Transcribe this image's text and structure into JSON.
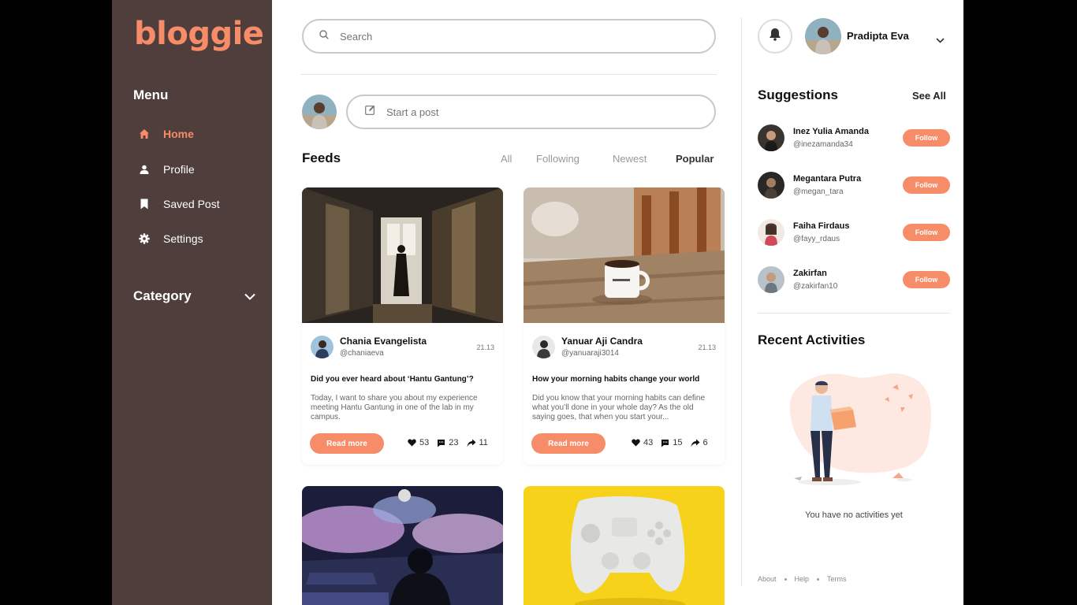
{
  "brand": {
    "logo": "bloggie",
    "accent": "#f78c68",
    "sidebar_bg": "#4f3e3c"
  },
  "sidebar": {
    "menu_title": "Menu",
    "items": [
      {
        "label": "Home",
        "icon": "home-icon",
        "active": true
      },
      {
        "label": "Profile",
        "icon": "user-icon"
      },
      {
        "label": "Saved Post",
        "icon": "bookmark-icon"
      },
      {
        "label": "Settings",
        "icon": "gear-icon"
      }
    ],
    "category_label": "Category"
  },
  "search": {
    "placeholder": "Search"
  },
  "composer": {
    "placeholder": "Start a post"
  },
  "feeds": {
    "title": "Feeds",
    "filters": [
      "All",
      "Following",
      "Newest",
      "Popular"
    ],
    "active_filter": "Popular",
    "posts": [
      {
        "author": "Chania Evangelista",
        "handle": "@chaniaeva",
        "time": "21.13",
        "title": "Did you ever heard about ‘Hantu Gantung’?",
        "excerpt": "Today, I want to share you about my experience meeting Hantu Gantung in one of the lab in my campus.",
        "button": "Read more",
        "likes": "53",
        "comments": "23",
        "shares": "11"
      },
      {
        "author": "Yanuar Aji Candra",
        "handle": "@yanuaraji3014",
        "time": "21.13",
        "title": "How your morning habits change your world",
        "excerpt": "Did you know that your morning habits can define what you’ll done in your whole day? As the old saying goes, that when you start your...",
        "button": "Read more",
        "likes": "43",
        "comments": "15",
        "shares": "6"
      }
    ]
  },
  "header": {
    "user_name": "Pradipta Eva"
  },
  "suggestions": {
    "title": "Suggestions",
    "see_all": "See All",
    "items": [
      {
        "name": "Inez Yulia Amanda",
        "handle": "@inezamanda34",
        "button": "Follow"
      },
      {
        "name": "Megantara Putra",
        "handle": "@megan_tara",
        "button": "Follow"
      },
      {
        "name": "Faiha Firdaus",
        "handle": "@fayy_rdaus",
        "button": "Follow"
      },
      {
        "name": "Zakirfan",
        "handle": "@zakirfan10",
        "button": "Follow"
      }
    ]
  },
  "activities": {
    "title": "Recent Activities",
    "empty_text": "You have no activities yet"
  },
  "footer": {
    "links": [
      "About",
      "Help",
      "Terms"
    ]
  }
}
